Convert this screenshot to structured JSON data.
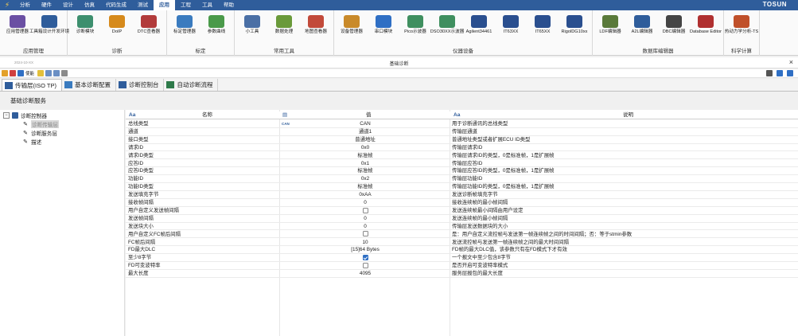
{
  "menubar": {
    "items": [
      "分析",
      "硬件",
      "设计",
      "仿真",
      "代码生成",
      "测试",
      "应用",
      "工程",
      "工具",
      "帮助"
    ],
    "active_index": 6,
    "brand": "TOSUN"
  },
  "ribbon": {
    "groups": [
      {
        "title": "应用管理",
        "buttons": [
          {
            "label": "应用管理器",
            "icon": "app-manager-icon",
            "color": "#6a4fa3"
          },
          {
            "label": "工具箱设计开发环境",
            "icon": "toolbox-icon",
            "color": "#2f5d9b"
          }
        ]
      },
      {
        "title": "诊断",
        "buttons": [
          {
            "label": "诊断模块",
            "icon": "diagnostic-module-icon",
            "color": "#3d8f6e"
          },
          {
            "label": "DoIP",
            "icon": "doip-icon",
            "color": "#d68a1c"
          },
          {
            "label": "DTC查看器",
            "icon": "dtc-viewer-icon",
            "color": "#b23b3b"
          }
        ]
      },
      {
        "title": "标定",
        "buttons": [
          {
            "label": "标定管理器",
            "icon": "calibration-manager-icon",
            "color": "#3a7bbf"
          },
          {
            "label": "参数曲线",
            "icon": "parameter-curve-icon",
            "color": "#4a9a4a"
          }
        ]
      },
      {
        "title": "常用工具",
        "buttons": [
          {
            "label": "小工具",
            "icon": "wrench-icon",
            "color": "#4a6fa5"
          },
          {
            "label": "数据处理",
            "icon": "data-processing-icon",
            "color": "#6a9a3a"
          },
          {
            "label": "地图查看器",
            "icon": "map-viewer-icon",
            "color": "#c24a3a"
          }
        ]
      },
      {
        "title": "仪器设备",
        "buttons": [
          {
            "label": "设备管理器",
            "icon": "device-manager-icon",
            "color": "#c98a2a"
          },
          {
            "label": "串口模块",
            "icon": "serial-port-icon",
            "color": "#2f6fc4"
          },
          {
            "label": "Pico示波器",
            "icon": "pico-scope-icon",
            "color": "#3f8f5f"
          },
          {
            "label": "DSO30XX示波器",
            "icon": "dso-scope-icon",
            "color": "#3f8f5f"
          },
          {
            "label": "Agilent34461",
            "icon": "agilent-icon",
            "color": "#2a4f8f"
          },
          {
            "label": "IT63XX",
            "icon": "it63xx-icon",
            "color": "#2a4f8f"
          },
          {
            "label": "IT65XX",
            "icon": "it65xx-icon",
            "color": "#2a4f8f"
          },
          {
            "label": "RigolDG10xx",
            "icon": "rigol-icon",
            "color": "#2a4f8f"
          }
        ]
      },
      {
        "title": "数据库编辑器",
        "buttons": [
          {
            "label": "LDF编辑器",
            "icon": "ldf-editor-icon",
            "color": "#5a7a3a"
          },
          {
            "label": "A2L编辑器",
            "icon": "a2l-editor-icon",
            "color": "#2f5d9b"
          },
          {
            "label": "DBC编辑器",
            "icon": "dbc-editor-icon",
            "color": "#444"
          },
          {
            "label": "Database Editor",
            "icon": "database-editor-icon",
            "color": "#b03030"
          }
        ]
      },
      {
        "title": "科学计算",
        "buttons": [
          {
            "label": "热动力学分析-TS",
            "icon": "thermo-analysis-icon",
            "color": "#c0502a"
          }
        ]
      }
    ]
  },
  "window": {
    "date": "2024-10-XX",
    "title": "基础诊断",
    "close": "×"
  },
  "toolbar": {
    "label": "使能"
  },
  "tabs": [
    {
      "label": "传输层(ISO TP)",
      "icon": "transport-layer-icon"
    },
    {
      "label": "基本诊断配置",
      "icon": "basic-config-icon"
    },
    {
      "label": "诊断控制台",
      "icon": "diagnostic-console-icon"
    },
    {
      "label": "自动诊断流程",
      "icon": "auto-flow-icon"
    }
  ],
  "section_title": "基础诊断服务",
  "tree": {
    "root": "诊断控制器",
    "children": [
      "诊断传输层",
      "诊断服务层",
      "描述"
    ],
    "selected_index": 0
  },
  "grid": {
    "headers": {
      "name": "名称",
      "value": "值",
      "description": "说明"
    },
    "rows": [
      {
        "name": "总线类型",
        "value": "CAN",
        "desc": "用于诊断通讯的总线类型",
        "tag": "CAN"
      },
      {
        "name": "通道",
        "value": "通道1",
        "desc": "传输层通道"
      },
      {
        "name": "接口类型",
        "value": "普通地址",
        "desc": "普通地址类型或者扩展ECU ID类型"
      },
      {
        "name": "请求ID",
        "value": "0x0",
        "desc": "传输层请求ID"
      },
      {
        "name": "请求ID类型",
        "value": "标准帧",
        "desc": "传输层请求ID的类型，0是标准帧，1是扩展帧"
      },
      {
        "name": "应答ID",
        "value": "0x1",
        "desc": "传输层应答ID"
      },
      {
        "name": "应答ID类型",
        "value": "标准帧",
        "desc": "传输层应答ID的类型，0是标准帧，1是扩展帧"
      },
      {
        "name": "功能ID",
        "value": "0x2",
        "desc": "传输层功能ID"
      },
      {
        "name": "功能ID类型",
        "value": "标准帧",
        "desc": "传输层功能ID的类型，0是标准帧，1是扩展帧"
      },
      {
        "name": "发送填充字节",
        "value": "0xAA",
        "desc": "发送诊断帧填充字节"
      },
      {
        "name": "接收帧间隔",
        "value": "0",
        "desc": "接收连续帧的最小帧间隔"
      },
      {
        "name": "用户自定义发送帧间隔",
        "checkbox": false,
        "desc": "发送连续帧最小间隔由用户设定"
      },
      {
        "name": "发送帧间隔",
        "value": "0",
        "desc": "发送连续帧的最小帧间隔"
      },
      {
        "name": "发送块大小",
        "value": "0",
        "desc": "传输层发送数据块的大小"
      },
      {
        "name": "用户自定义FC帧后间隔",
        "checkbox": false,
        "desc": "是：用户自定义流控帧与发送第一帧连续帧之间的时间间隔；否：等于stmin参数"
      },
      {
        "name": "FC帧后间隔",
        "value": "10",
        "desc": "发送流控帧与发送第一帧连续帧之间的最大时间间隔"
      },
      {
        "name": "FD最大DLC",
        "value": "[15]64 Bytes",
        "desc": "FD帧的最大DLC值，该参数只有在FD模式下才有效"
      },
      {
        "name": "至少8字节",
        "checkbox": true,
        "desc": "一个报文中至少包含8字节"
      },
      {
        "name": "FD可变波特率",
        "checkbox": false,
        "desc": "是否开启可变波特率模式"
      },
      {
        "name": "最大长度",
        "value": "4095",
        "desc": "服务层报包的最大长度"
      }
    ]
  }
}
